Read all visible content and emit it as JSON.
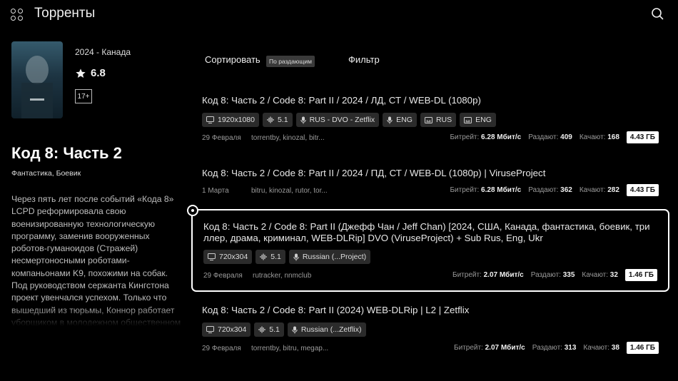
{
  "header": {
    "title": "Торренты",
    "menu_icon": "grid-icon",
    "search_icon": "search-icon"
  },
  "movie": {
    "year_country": "2024 - Канада",
    "rating": "6.8",
    "age": "17+",
    "title": "Код 8: Часть 2",
    "genres": "Фантастика, Боевик",
    "description": "Через пять лет после событий «Кода 8» LCPD реформировала свою военизированную технологическую программу, заменив вооруженных роботов-гуманоидов (Стражей) несмертоносными роботами-компаньонами K9, похожими на собак. Под руководством сержанта Кингстона проект увенчался успехом. Только что вышедший из тюрьмы, Коннор работает уборщиком в молодежном общественном"
  },
  "controls": {
    "sort_label": "Сортировать",
    "sort_value": "По раздающим",
    "filter_label": "Фильтр"
  },
  "labels": {
    "bitrate": "Битрейт:",
    "seeders": "Раздают:",
    "leechers": "Качают:"
  },
  "torrents": [
    {
      "title": "Код 8: Часть 2 / Code 8: Part II / 2024 / ЛД, СТ / WEB-DL (1080p)",
      "chips": [
        "1920x1080",
        "5.1",
        "RUS - DVO - Zetflix",
        "ENG",
        "RUS",
        "ENG"
      ],
      "date": "29 Февраля",
      "trackers": "torrentby, kinozal, bitr...",
      "bitrate": "6.28 Мбит/с",
      "seeders": "409",
      "leechers": "168",
      "size": "4.43 ГБ"
    },
    {
      "title": "Код 8: Часть 2 / Code 8: Part II / 2024 / ПД, СТ / WEB-DL (1080p) | ViruseProject",
      "chips": [],
      "date": "1 Марта",
      "trackers": "bitru, kinozal, rutor, tor...",
      "bitrate": "6.28 Мбит/с",
      "seeders": "362",
      "leechers": "282",
      "size": "4.43 ГБ"
    },
    {
      "title_line1": "Код 8: Часть 2 / Code 8: Part II (Джефф Чан / Jeff Chan) [2024, США, Канада, фантастика, боевик, три",
      "title_line2": "ллер, драма, криминал, WEB-DLRip] DVO (ViruseProject) + Sub Rus, Eng, Ukr",
      "chips": [
        "720x304",
        "5.1",
        "Russian (...Project)"
      ],
      "date": "29 Февраля",
      "trackers": "rutracker, nnmclub",
      "bitrate": "2.07 Мбит/с",
      "seeders": "335",
      "leechers": "32",
      "size": "1.46 ГБ"
    },
    {
      "title": "Код 8: Часть 2 / Code 8: Part II (2024) WEB-DLRip | L2 | Zetflix",
      "chips": [
        "720x304",
        "5.1",
        "Russian (...Zetflix)"
      ],
      "date": "29 Февраля",
      "trackers": "torrentby, bitru, megap...",
      "bitrate": "2.07 Мбит/с",
      "seeders": "313",
      "leechers": "38",
      "size": "1.46 ГБ"
    }
  ]
}
